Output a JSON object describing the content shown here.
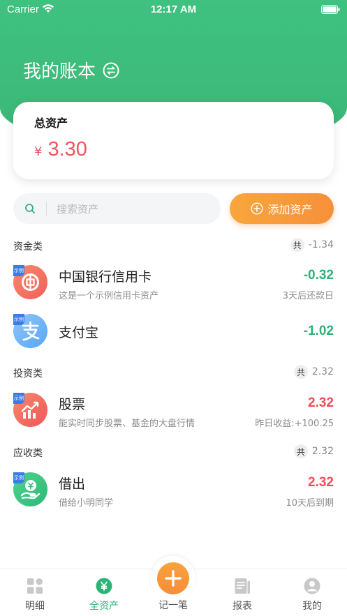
{
  "status_bar": {
    "carrier": "Carrier",
    "time": "12:17 AM"
  },
  "header": {
    "title": "我的账本",
    "switch_icon": "switch-arrows-icon"
  },
  "summary": {
    "label": "总资产",
    "currency": "¥",
    "amount": "3.30"
  },
  "search": {
    "placeholder": "搜索资产"
  },
  "add_button": {
    "label": "添加资产"
  },
  "sections": [
    {
      "title": "资金类",
      "total_badge": "共",
      "total": "-1.34",
      "items": [
        {
          "name": "中国银行信用卡",
          "subtitle": "这是一个示例信用卡资产",
          "value": "-0.32",
          "note": "3天后还款日",
          "tag": "示例",
          "icon": "bank-of-china-icon"
        },
        {
          "name": "支付宝",
          "subtitle": "",
          "value": "-1.02",
          "note": "",
          "tag": "示例",
          "icon": "alipay-icon"
        }
      ]
    },
    {
      "title": "投资类",
      "total_badge": "共",
      "total": "2.32",
      "items": [
        {
          "name": "股票",
          "subtitle": "能实时同步股票、基金的大盘行情",
          "value": "2.32",
          "note": "昨日收益:+100.25",
          "tag": "示例",
          "icon": "stock-chart-icon"
        }
      ]
    },
    {
      "title": "应收类",
      "total_badge": "共",
      "total": "2.32",
      "items": [
        {
          "name": "借出",
          "subtitle": "借给小明同学",
          "value": "2.32",
          "note": "10天后到期",
          "tag": "示例",
          "icon": "lend-money-icon"
        }
      ]
    }
  ],
  "tabs": [
    {
      "label": "明细",
      "icon": "grid-icon",
      "active": false
    },
    {
      "label": "全资产",
      "icon": "yen-icon",
      "active": true
    },
    {
      "label": "记一笔",
      "icon": "plus-icon",
      "active": false
    },
    {
      "label": "报表",
      "icon": "report-icon",
      "active": false
    },
    {
      "label": "我的",
      "icon": "user-icon",
      "active": false
    }
  ],
  "colors": {
    "brand_green": "#3bb777",
    "accent_orange": "#f7903a",
    "negative_green": "#2db378",
    "positive_red": "#ef4e5a"
  }
}
